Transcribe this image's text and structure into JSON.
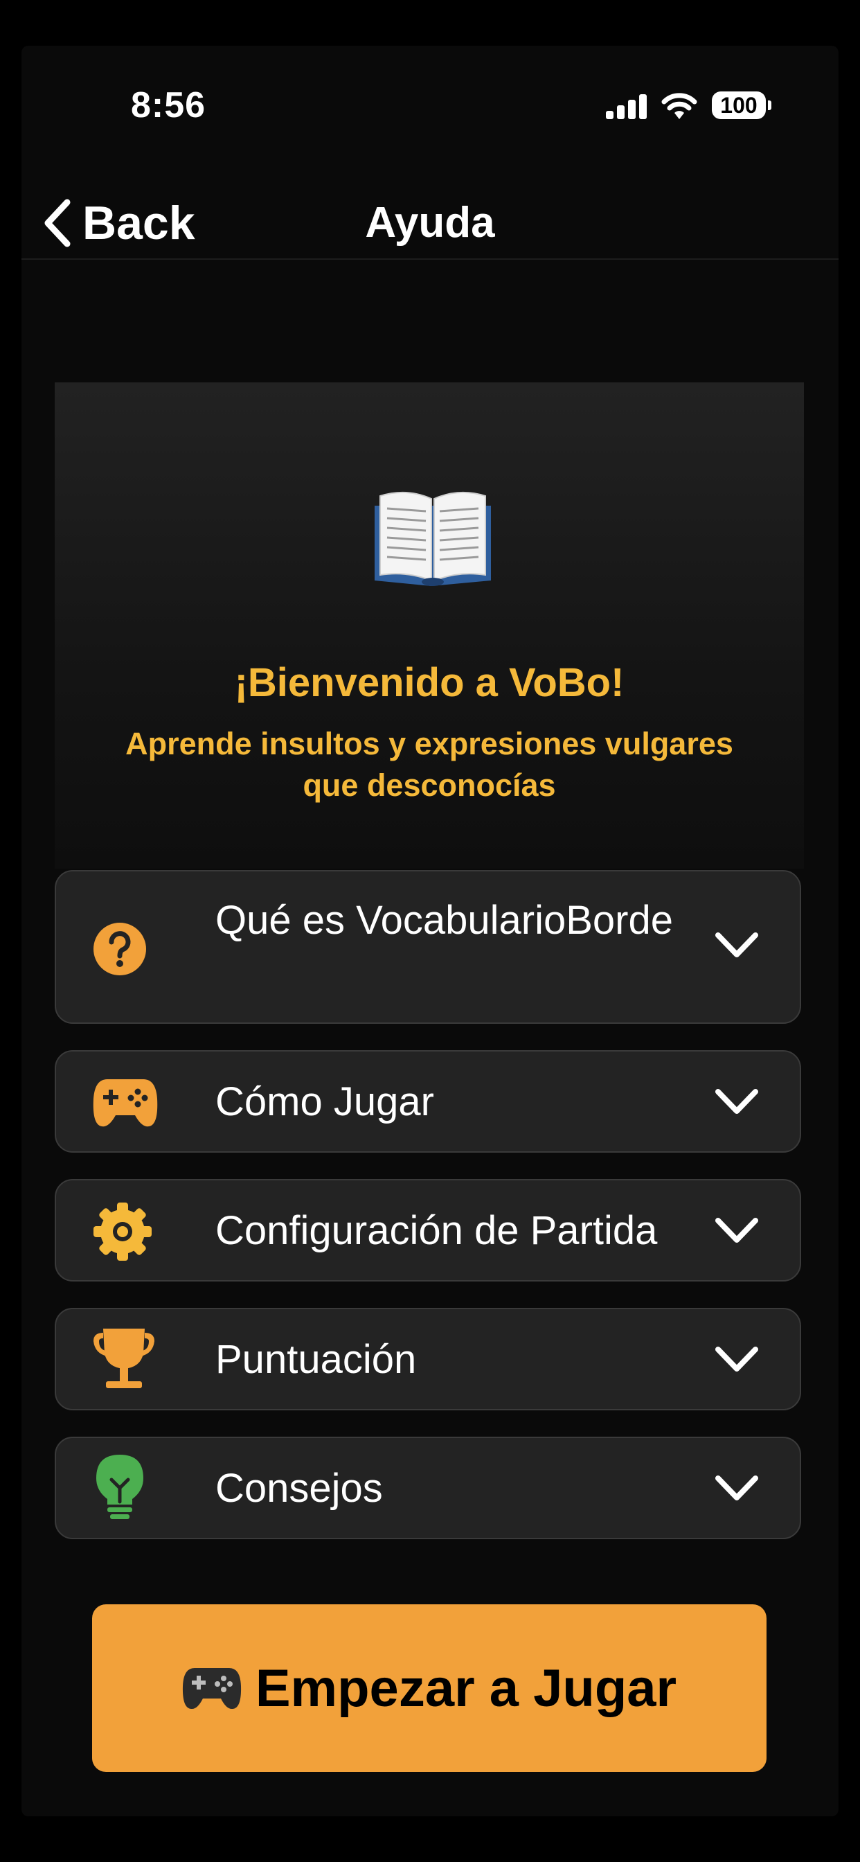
{
  "status_bar": {
    "time": "8:56",
    "battery": "100",
    "icons": [
      "signal-icon",
      "wifi-icon",
      "battery-icon"
    ]
  },
  "nav": {
    "back_label": "Back",
    "title": "Ayuda"
  },
  "hero": {
    "icon": "book-icon",
    "title": "¡Bienvenido a VoBo!",
    "subtitle": "Aprende insultos y expresiones vulgares que desconocías"
  },
  "sections": [
    {
      "label": "Qué es VocabularioBorde",
      "icon": "question-circle-icon",
      "color": "#f2a13a"
    },
    {
      "label": "Cómo Jugar",
      "icon": "gamepad-icon",
      "color": "#f2a13a"
    },
    {
      "label": "Configuración de Partida",
      "icon": "gear-icon",
      "color": "#f5b93a"
    },
    {
      "label": "Puntuación",
      "icon": "trophy-icon",
      "color": "#f2a13a"
    },
    {
      "label": "Consejos",
      "icon": "lightbulb-icon",
      "color": "#4caf50"
    }
  ],
  "start_button": {
    "label": "Empezar a Jugar",
    "icon": "controller-icon",
    "color": "#f2a13a"
  },
  "colors": {
    "accent": "#f2a13a",
    "highlight_text": "#f5b93a",
    "background": "#0a0a0a",
    "card": "#232323"
  }
}
